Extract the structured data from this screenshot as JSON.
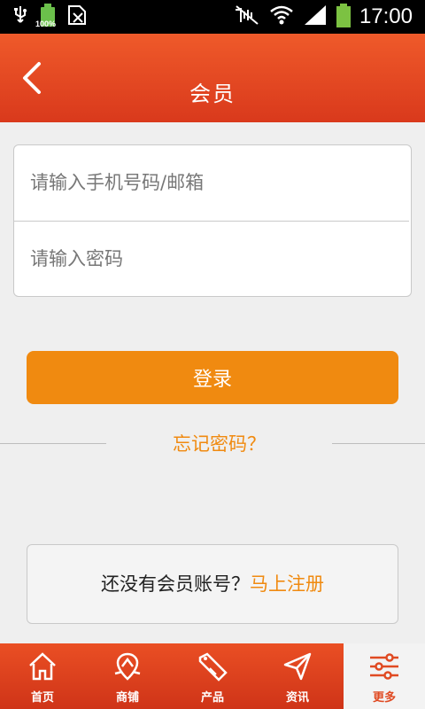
{
  "status_bar": {
    "time": "17:00",
    "battery_left_text": "100%",
    "icons": [
      "usb-icon",
      "battery-icon",
      "sim-icon",
      "mute-icon",
      "wifi-icon",
      "signal-icon",
      "battery-icon"
    ]
  },
  "header": {
    "title": "会员",
    "back_icon": "chevron-left-icon"
  },
  "form": {
    "account_placeholder": "请输入手机号码/邮箱",
    "password_placeholder": "请输入密码"
  },
  "actions": {
    "login_label": "登录",
    "forgot_label": "忘记密码？"
  },
  "register": {
    "prompt": "还没有会员账号？",
    "link": "马上注册"
  },
  "tabbar": {
    "tabs": [
      {
        "label": "首页",
        "icon": "home-icon"
      },
      {
        "label": "商铺",
        "icon": "shop-icon"
      },
      {
        "label": "产品",
        "icon": "sale-tag-icon"
      },
      {
        "label": "资讯",
        "icon": "paper-plane-icon"
      },
      {
        "label": "更多",
        "icon": "sliders-icon"
      }
    ],
    "active_index": 4
  },
  "colors": {
    "header": "#e04a22",
    "accent": "#f08a10",
    "background": "#efefef"
  }
}
